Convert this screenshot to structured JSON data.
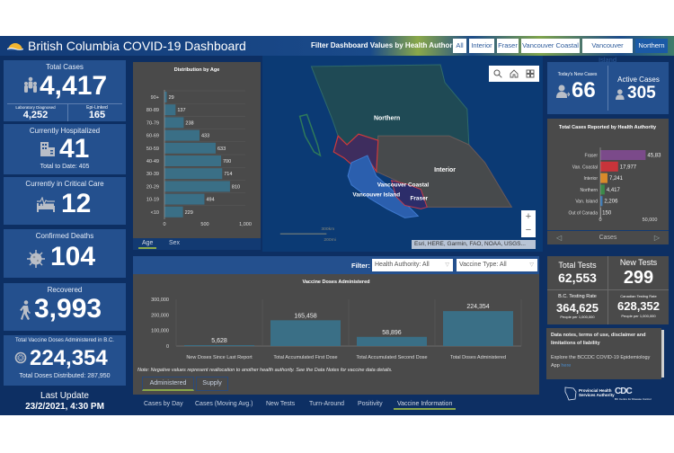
{
  "header": {
    "title": "British Columbia COVID-19 Dashboard",
    "filter_label": "Filter Dashboard Values by Health Authority:",
    "filters": [
      "All",
      "Interior",
      "Fraser",
      "Vancouver Coastal",
      "Vancouver Island",
      "Northern"
    ],
    "selected_filter": "Northern"
  },
  "left": {
    "total_cases": {
      "label": "Total Cases",
      "value": "4,417",
      "lab_label": "Laboratory Diagnosed",
      "lab_value": "4,252",
      "epi_label": "Epi-Linked",
      "epi_value": "165",
      "icon": "people-icon"
    },
    "hospitalized": {
      "label": "Currently Hospitalized",
      "value": "41",
      "sub": "Total to Date: 405",
      "icon": "hospital-icon"
    },
    "critical": {
      "label": "Currently in Critical Care",
      "value": "12",
      "icon": "bed-icon"
    },
    "deaths": {
      "label": "Confirmed Deaths",
      "value": "104",
      "icon": "virus-icon"
    },
    "recovered": {
      "label": "Recovered",
      "value": "3,993",
      "icon": "walking-icon"
    },
    "vaccine": {
      "label": "Total Vaccine Doses Administered in B.C.",
      "value": "224,354",
      "sub": "Total Doses Distributed: 287,950",
      "icon": "vaccine-icon"
    },
    "last_update": {
      "label": "Last Update",
      "value": "23/2/2021, 4:30 PM"
    }
  },
  "age_chart": {
    "tabs": [
      "Age",
      "Sex"
    ],
    "active_tab": "Age"
  },
  "map": {
    "regions": [
      "Northern",
      "Interior",
      "Vancouver Coastal",
      "Vancouver Island",
      "Fraser"
    ],
    "scale_km": "300km",
    "scale_mi": "200mi",
    "attribution": "Esri, HERE, Garmin, FAO, NOAA, USGS...",
    "zoom_in": "+",
    "zoom_out": "−"
  },
  "right": {
    "new_cases": {
      "label": "Today's New Cases",
      "value": "66"
    },
    "active_cases": {
      "label": "Active Cases",
      "value": "305"
    },
    "ha_chart_nav": {
      "label": "Cases",
      "prev": "◁",
      "next": "▷"
    },
    "tests": {
      "total_label": "Total Tests",
      "total_value": "62,553",
      "new_label": "New Tests",
      "new_value": "299",
      "bc_rate_label": "B.C. Testing Rate",
      "bc_rate_value": "364,625",
      "bc_rate_unit": "People per 1,000,000",
      "ca_rate_label": "Canadian Testing Rate",
      "ca_rate_value": "628,352",
      "ca_rate_unit": "People per 1,000,000"
    },
    "notes": {
      "line1": "Data notes, terms of use, disclaimer and limitations of liability",
      "line2": "Explore the BCCDC COVID-19 Epidemiology App ",
      "link": "here",
      "phsa": "Provincial Health Services Authority",
      "bccdc": "BC Centre for Disease Control"
    }
  },
  "vaccine_panel": {
    "filter_label": "Filter:",
    "ha_select": "Health Authority: All",
    "type_select": "Vaccine Type: All",
    "note": "Note: Negative values represent reallocation to another health authority. See the Data Notes for vaccine data details.",
    "tabs": [
      "Administered",
      "Supply"
    ],
    "active_tab": "Administered"
  },
  "bottom_tabs": [
    "Cases by Day",
    "Cases (Moving Avg.)",
    "New Tests",
    "Turn-Around",
    "Positivity",
    "Vaccine Information"
  ],
  "bottom_active": "Vaccine Information",
  "chart_data": [
    {
      "type": "bar",
      "orientation": "horizontal",
      "title": "Distribution by Age",
      "categories": [
        "90+",
        "80-89",
        "70-79",
        "60-69",
        "50-59",
        "40-49",
        "30-39",
        "20-29",
        "10-19",
        "<10"
      ],
      "values": [
        29,
        137,
        238,
        433,
        633,
        700,
        714,
        810,
        494,
        229
      ],
      "xticks": [
        "0",
        "500",
        "1,000"
      ],
      "xlim": [
        0,
        1000
      ],
      "color": "#3a6f86"
    },
    {
      "type": "bar",
      "orientation": "horizontal",
      "title": "Total Cases Reported by Health Authority",
      "categories": [
        "Fraser",
        "Van. Coastal",
        "Interior",
        "Northern",
        "Van. Island",
        "Out of Canada"
      ],
      "values": [
        45830,
        17977,
        7241,
        4417,
        2206,
        150
      ],
      "labels": [
        "45,83",
        "17,977",
        "7,241",
        "4,417",
        "2,206",
        "150"
      ],
      "colors": [
        "#7b4a8a",
        "#c8343a",
        "#d98a2a",
        "#3c8a4a",
        "#3a7ab8",
        "#888888"
      ],
      "xticks": [
        "0",
        "50,000"
      ],
      "xlim": [
        0,
        60000
      ]
    },
    {
      "type": "bar",
      "title": "Vaccine Doses Administered",
      "categories": [
        "New Doses Since Last Report",
        "Total Accumulated First Dose",
        "Total Accumulated Second Dose",
        "Total Doses Administered"
      ],
      "values": [
        5628,
        165458,
        58896,
        224354
      ],
      "labels": [
        "5,628",
        "165,458",
        "58,896",
        "224,354"
      ],
      "yticks": [
        "0",
        "100,000",
        "200,000",
        "300,000"
      ],
      "ylim": [
        0,
        300000
      ],
      "color": "#3a6f86"
    }
  ]
}
